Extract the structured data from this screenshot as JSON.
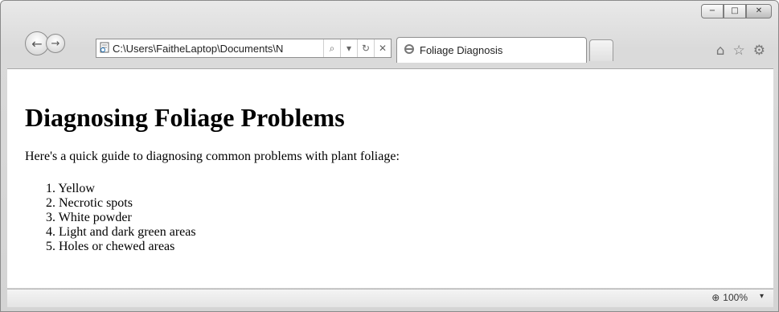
{
  "window": {
    "minimize_glyph": "−",
    "maximize_glyph": "□",
    "close_glyph": "✕"
  },
  "nav": {
    "back_glyph": "←",
    "forward_glyph": "→"
  },
  "address_bar": {
    "url": "C:\\Users\\FaitheLaptop\\Documents\\N",
    "search_glyph": "⌕",
    "dropdown_glyph": "▾",
    "refresh_glyph": "↻",
    "stop_glyph": "✕"
  },
  "tab": {
    "title": "Foliage Diagnosis"
  },
  "toolbar": {
    "home_glyph": "⌂",
    "favorites_glyph": "☆",
    "tools_glyph": "⚙"
  },
  "page": {
    "heading": "Diagnosing Foliage Problems",
    "intro": "Here's a quick guide to diagnosing common problems with plant foliage:",
    "items": [
      "1.  Yellow",
      "2.  Necrotic spots",
      "3.  White powder",
      "4.  Light and dark green areas",
      "5.  Holes or chewed areas"
    ]
  },
  "status_bar": {
    "zoom_glyph": "⊕",
    "zoom": "100%",
    "zoom_dropdown_glyph": "▾"
  }
}
